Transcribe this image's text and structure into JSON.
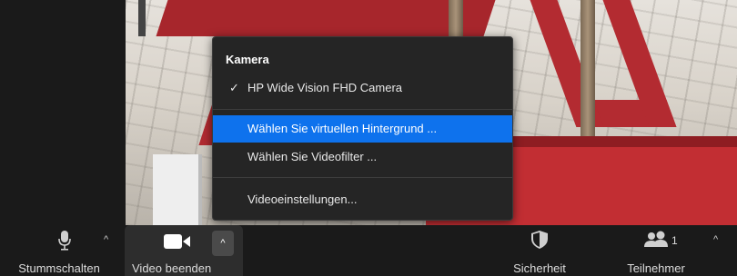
{
  "menu": {
    "header": "Kamera",
    "items": [
      {
        "label": "HP Wide Vision FHD Camera",
        "checked": true
      },
      {
        "label": "Wählen Sie virtuellen Hintergrund ...",
        "selected": true
      },
      {
        "label": "Wählen Sie Videofilter ..."
      },
      {
        "label": "Videoeinstellungen..."
      }
    ],
    "check_glyph": "✓"
  },
  "toolbar": {
    "mute_label": "Stummschalten",
    "video_label": "Video beenden",
    "security_label": "Sicherheit",
    "participants_label": "Teilnehmer",
    "participants_count": "1",
    "caret_glyph": "^"
  },
  "colors": {
    "selected_bg": "#0e72ed",
    "menu_bg": "#252525",
    "toolbar_bg": "#1a1a1a"
  }
}
